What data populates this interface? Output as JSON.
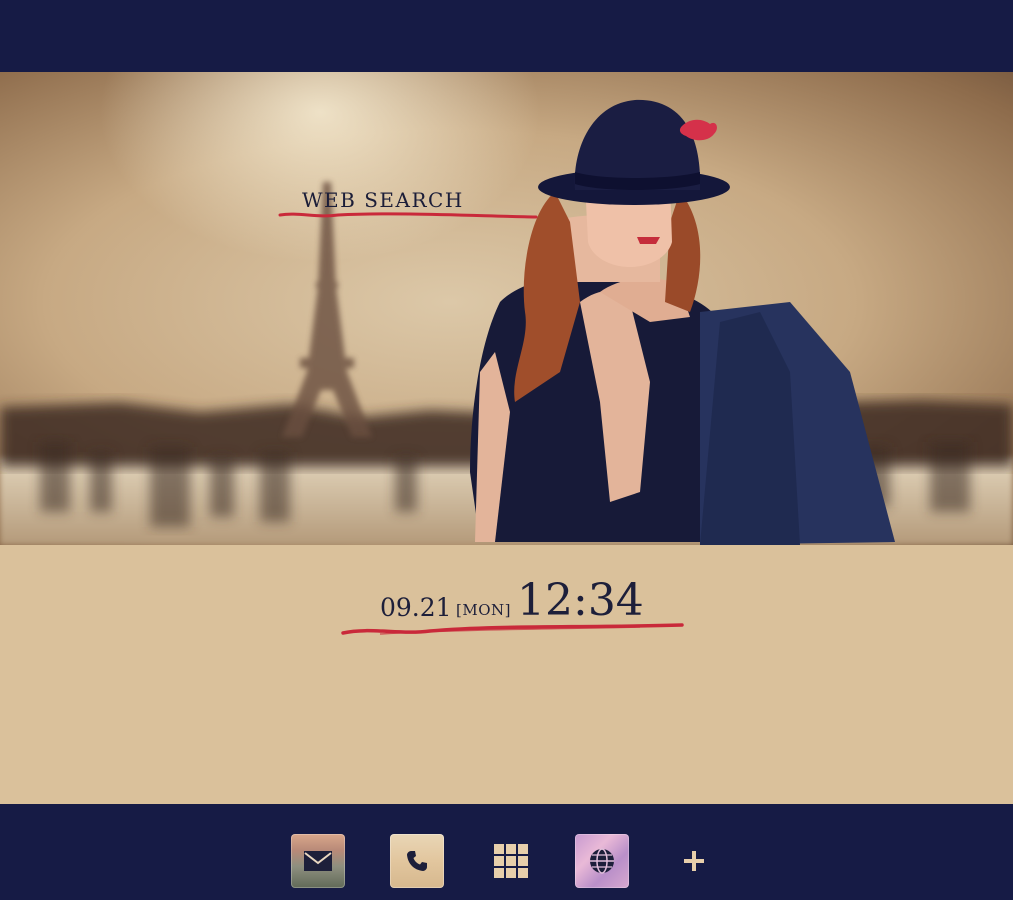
{
  "wallpaper": {
    "web_search_label": "WEB SEARCH",
    "accent_color": "#c9293a"
  },
  "clock": {
    "date": "09.21",
    "day": "[MON]",
    "time": "12:34"
  },
  "dock": {
    "icons": [
      {
        "name": "mail-icon"
      },
      {
        "name": "phone-icon"
      },
      {
        "name": "app-drawer-icon"
      },
      {
        "name": "browser-globe-icon"
      },
      {
        "name": "add-icon"
      }
    ]
  },
  "colors": {
    "bar": "#161b45",
    "clock_panel": "#dac19b",
    "text": "#1d1f3a"
  }
}
